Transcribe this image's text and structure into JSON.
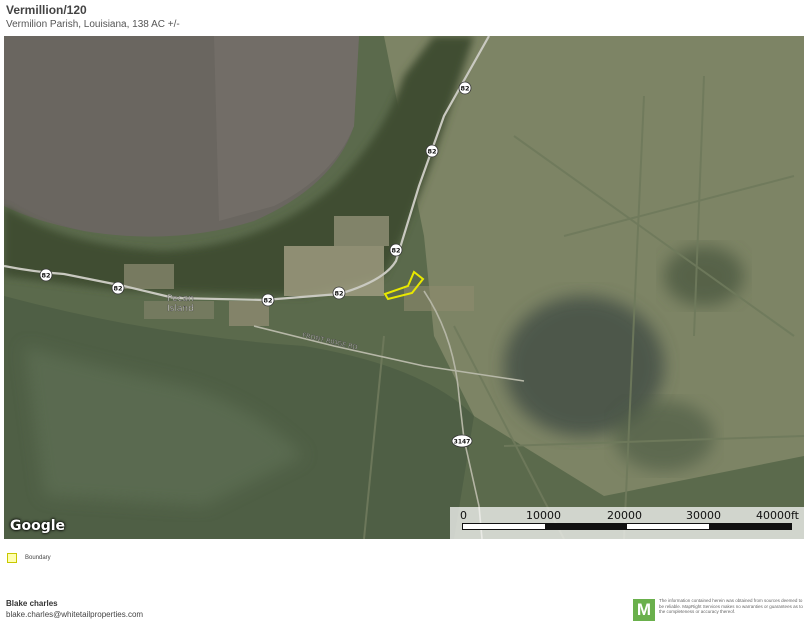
{
  "header": {
    "title": "Vermillion/120",
    "subtitle": "Vermilion Parish, Louisiana, 138 AC +/-"
  },
  "map": {
    "attribution": "Google",
    "place_labels": {
      "pecan": "Pecan",
      "island": "Island",
      "front_ridge_rd": "FRONT RIDGE RD"
    },
    "route_shields": [
      "82",
      "82",
      "82",
      "82",
      "82",
      "82",
      "82",
      "3147"
    ],
    "boundary_color": "#e8e800",
    "scale_bar": {
      "ticks": [
        "0",
        "10000",
        "20000",
        "30000",
        "40000ft"
      ]
    }
  },
  "legend": {
    "boundary_label": "Boundary"
  },
  "footer": {
    "agent_name": "Blake charles",
    "agent_email": "blake.charles@whitetailproperties.com",
    "logo_letter": "M",
    "disclaimer": "The information contained herein was obtained from sources deemed to be reliable. MapRight Services makes no warranties or guarantees as to the completeness or accuracy thereof."
  }
}
